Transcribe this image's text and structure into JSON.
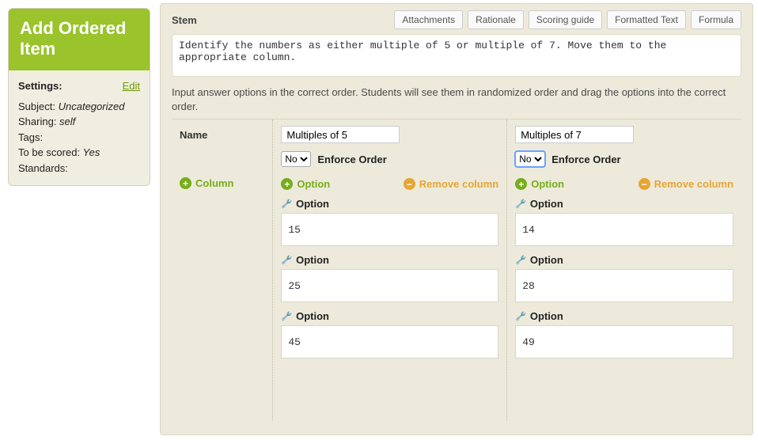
{
  "sidebar": {
    "title": "Add Ordered Item",
    "settings_label": "Settings:",
    "edit_label": "Edit",
    "subject_label": "Subject:",
    "subject_value": "Uncategorized",
    "sharing_label": "Sharing:",
    "sharing_value": "self",
    "tags_label": "Tags:",
    "tags_value": "",
    "scored_label": "To be scored:",
    "scored_value": "Yes",
    "standards_label": "Standards:",
    "standards_value": ""
  },
  "toolbar": {
    "stem_label": "Stem",
    "buttons": {
      "attachments": "Attachments",
      "rationale": "Rationale",
      "scoring": "Scoring guide",
      "formatted": "Formatted Text",
      "formula": "Formula"
    }
  },
  "stem_text": "Identify the numbers as either multiple of 5 or multiple of 7. Move them to the appropriate column.",
  "instructions": "Input answer options in the correct order. Students will see them in randomized order and drag the options into the correct order.",
  "left": {
    "name_label": "Name",
    "add_column_label": "Column"
  },
  "enforce_label": "Enforce Order",
  "enforce_value": "No",
  "add_option_label": "Option",
  "remove_column_label": "Remove column",
  "option_heading": "Option",
  "columns": [
    {
      "name": "Multiples of 5",
      "options": [
        "15",
        "25",
        "45"
      ]
    },
    {
      "name": "Multiples of 7",
      "options": [
        "14",
        "28",
        "49"
      ]
    }
  ]
}
